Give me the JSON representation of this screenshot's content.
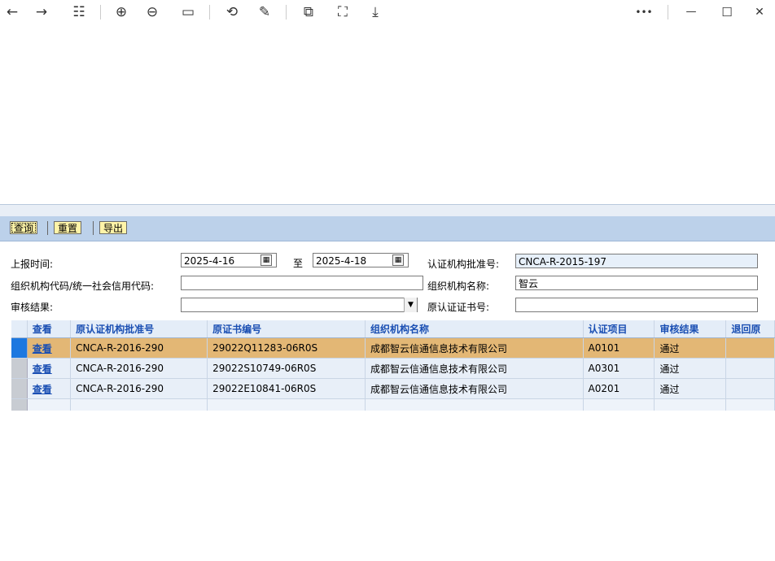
{
  "viewer_toolbar": {
    "icons": [
      "back-arrow-icon",
      "forward-arrow-icon",
      "grid-view-icon",
      "zoom-in-icon",
      "zoom-out-icon",
      "actual-size-icon",
      "rotate-icon",
      "edit-icon",
      "extract-icon",
      "crop-icon",
      "download-icon",
      "more-icon",
      "minimize-icon",
      "maximize-icon",
      "close-icon"
    ],
    "glyphs": {
      "back": "←",
      "forward": "→",
      "grid": "☷",
      "zoom_in": "⊕",
      "zoom_out": "⊖",
      "actual_size": "▭",
      "rotate": "⟲",
      "edit": "✎",
      "extract": "⧉",
      "crop": "⛶",
      "download": "⤓",
      "more": "•••",
      "minimize": "—",
      "maximize": "☐",
      "close": "✕"
    }
  },
  "buttons": {
    "query": "查询",
    "reset": "重置",
    "export": "导出"
  },
  "form": {
    "report_time_label": "上报时间:",
    "date_from": "2025-4-16",
    "to_label": "至",
    "date_to": "2025-4-18",
    "cert_body_approval_label": "认证机构批准号:",
    "cert_body_approval_value": "CNCA-R-2015-197",
    "org_code_label": "组织机构代码/统一社会信用代码:",
    "org_code_value": "",
    "org_name_label": "组织机构名称:",
    "org_name_value": "智云",
    "review_result_label": "审核结果:",
    "review_result_value": "",
    "orig_cert_no_label": "原认证证书号:",
    "orig_cert_no_value": ""
  },
  "table": {
    "headers": [
      "查看",
      "原认证机构批准号",
      "原证书编号",
      "组织机构名称",
      "认证项目",
      "审核结果",
      "退回原"
    ],
    "rows": [
      [
        "查看",
        "CNCA-R-2016-290",
        "29022Q11283-06R0S",
        "成都智云信通信息技术有限公司",
        "A0101",
        "通过",
        ""
      ],
      [
        "查看",
        "CNCA-R-2016-290",
        "29022S10749-06R0S",
        "成都智云信通信息技术有限公司",
        "A0301",
        "通过",
        ""
      ],
      [
        "查看",
        "CNCA-R-2016-290",
        "29022E10841-06R0S",
        "成都智云信通信息技术有限公司",
        "A0201",
        "通过",
        ""
      ]
    ],
    "selected_row_color": "#e3b775",
    "header_text_color": "#1a4fb3"
  }
}
